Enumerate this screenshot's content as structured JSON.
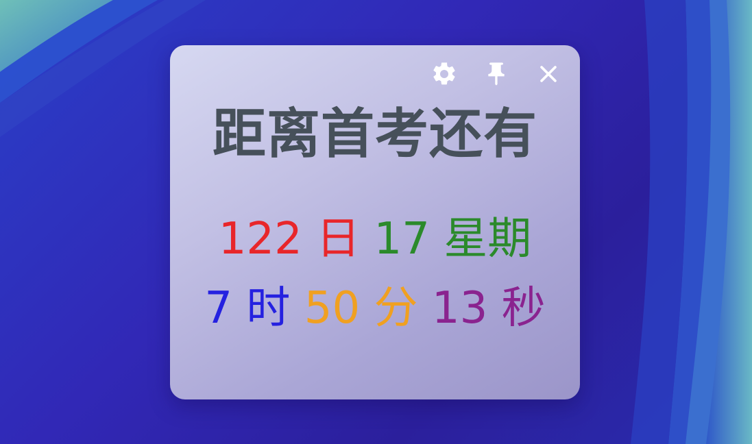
{
  "widget": {
    "title": "距离首考还有",
    "toolbar": {
      "settings_icon": "gear-icon",
      "pin_icon": "pin-icon",
      "close_icon": "close-icon"
    },
    "countdown": {
      "days": {
        "value": "122",
        "unit": "日",
        "color": "#e8262a"
      },
      "weeks": {
        "value": "17",
        "unit": "星期",
        "color": "#2b8a2b"
      },
      "hours": {
        "value": "7",
        "unit": "时",
        "color": "#2521e0"
      },
      "minutes": {
        "value": "50",
        "unit": "分",
        "color": "#f0a021"
      },
      "seconds": {
        "value": "13",
        "unit": "秒",
        "color": "#8a238f"
      }
    }
  }
}
